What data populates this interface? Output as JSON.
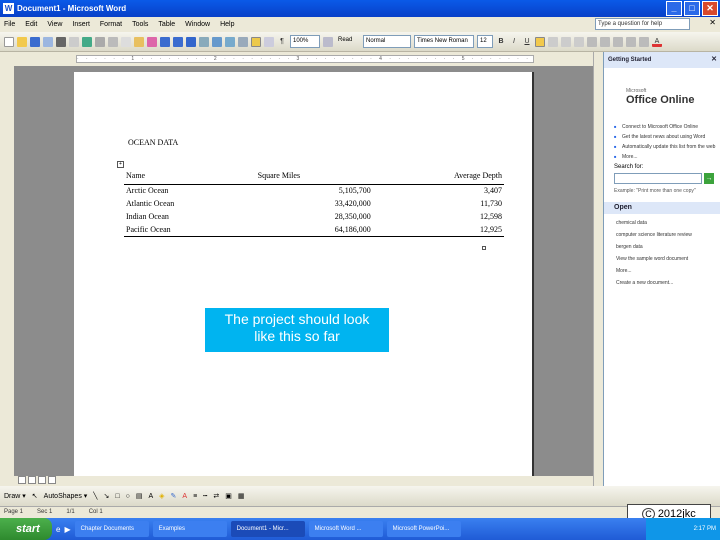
{
  "window": {
    "title": "Document1 - Microsoft Word",
    "app_icon": "W",
    "minimize": "_",
    "maximize": "□",
    "close": "✕"
  },
  "menu": {
    "items": [
      "File",
      "Edit",
      "View",
      "Insert",
      "Format",
      "Tools",
      "Table",
      "Window",
      "Help"
    ],
    "help_placeholder": "Type a question for help",
    "close": "✕"
  },
  "toolbar": {
    "zoom": "100%",
    "read_label": "Read",
    "style": "Normal",
    "font": "Times New Roman",
    "font_size": "12"
  },
  "ruler": {
    "ticks": "· · · · · · 1 · · · · · · · · 2 · · · · · · · · 3 · · · · · · · · 4 · · · · · · · · 5 · · · · · · · · 6 · · ·"
  },
  "document": {
    "heading": "OCEAN DATA",
    "table": {
      "headers": [
        "Name",
        "Square Miles",
        "Average Depth"
      ],
      "rows": [
        [
          "Arctic Ocean",
          "5,105,700",
          "3,407"
        ],
        [
          "Atlantic Ocean",
          "33,420,000",
          "11,730"
        ],
        [
          "Indian Ocean",
          "28,350,000",
          "12,598"
        ],
        [
          "Pacific Ocean",
          "64,186,000",
          "12,925"
        ]
      ]
    },
    "move_handle": "+"
  },
  "callout": {
    "line1": "The project should look",
    "line2": "like this so far"
  },
  "task_pane": {
    "title": "Getting Started",
    "logo_prefix": "Microsoft",
    "logo": "Office Online",
    "links": [
      "Connect to Microsoft Office Online",
      "Get the latest news about using Word",
      "Automatically update this list from the web"
    ],
    "more": "More...",
    "search_label": "Search for:",
    "search_example": "Example: \"Print more than one copy\"",
    "go": "→",
    "open_section": "Open",
    "open_items": [
      "chemical data",
      "computer science literature review",
      "bergen data",
      "View the sample word document",
      "More..."
    ],
    "create_new": "Create a new document..."
  },
  "drawbar": {
    "draw": "Draw ▾",
    "autoshapes": "AutoShapes ▾"
  },
  "statusbar": {
    "page": "Page 1",
    "sec": "Sec 1",
    "pos": "1/1",
    "col": "Col 1"
  },
  "copyright": {
    "symbol": "C",
    "text": "2012jkc"
  },
  "taskbar": {
    "start": "start",
    "tasks": [
      "Chapter Documents",
      "Examples",
      "Document1 - Micr...",
      "Microsoft Word ...",
      "Microsoft PowerPoi..."
    ],
    "clock": "2:17 PM"
  }
}
